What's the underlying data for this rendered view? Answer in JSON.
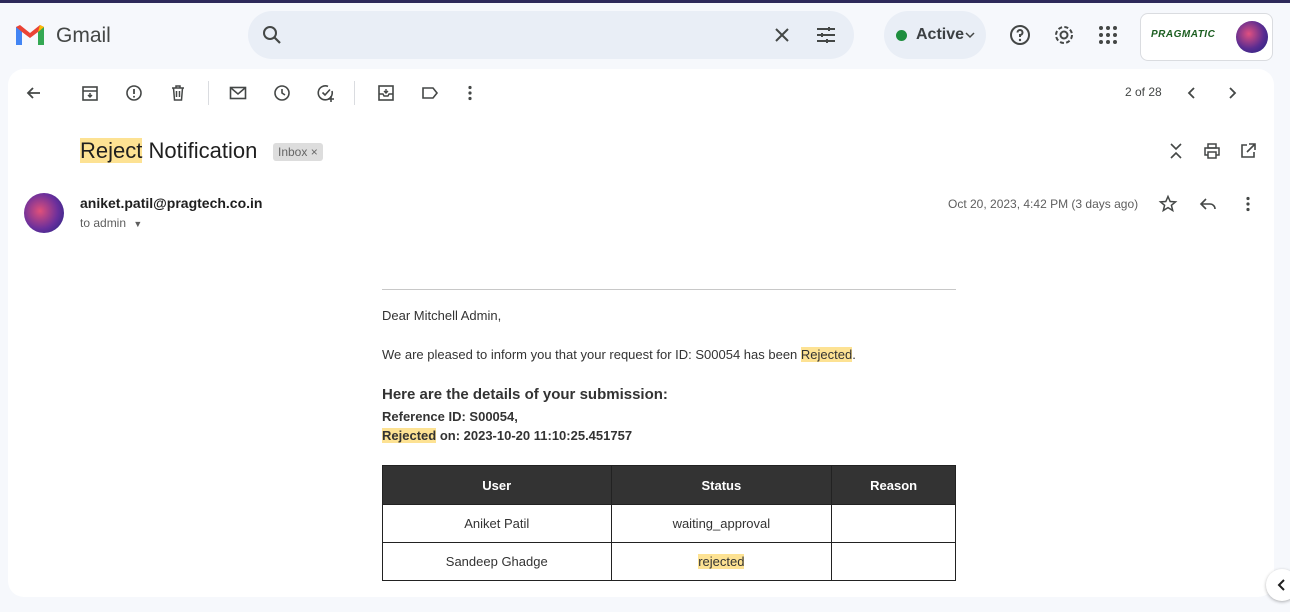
{
  "app": {
    "name": "Gmail"
  },
  "search": {
    "placeholder": "",
    "value": ""
  },
  "status": {
    "label": "Active",
    "color": "#1e8e3e"
  },
  "account": {
    "brand": "PRAGMATIC"
  },
  "toolbar": {
    "pager": "2 of 28"
  },
  "message": {
    "subject_highlight": "Reject",
    "subject_rest": " Notification",
    "label_chip": "Inbox",
    "sender": "aniket.patil@pragtech.co.in",
    "to": "to admin",
    "date": "Oct 20, 2023, 4:42 PM (3 days ago)"
  },
  "body": {
    "greeting": "Dear Mitchell Admin,",
    "intro_before": "We are pleased to inform you that your request for ID: S00054 has been ",
    "intro_highlight": "Rejected",
    "intro_after": ".",
    "details_heading": "Here are the details of your submission:",
    "reference": "Reference ID: S00054,",
    "rejected_label": "Rejected",
    "rejected_on": " on: 2023-10-20 11:10:25.451757"
  },
  "table": {
    "headers": [
      "User",
      "Status",
      "Reason"
    ],
    "rows": [
      {
        "user": "Aniket Patil",
        "status": "waiting_approval",
        "reason": ""
      },
      {
        "user": "Sandeep Ghadge",
        "status": "rejected",
        "reason": ""
      }
    ]
  },
  "colors": {
    "highlight": "#fde293",
    "table_header": "#333333"
  }
}
